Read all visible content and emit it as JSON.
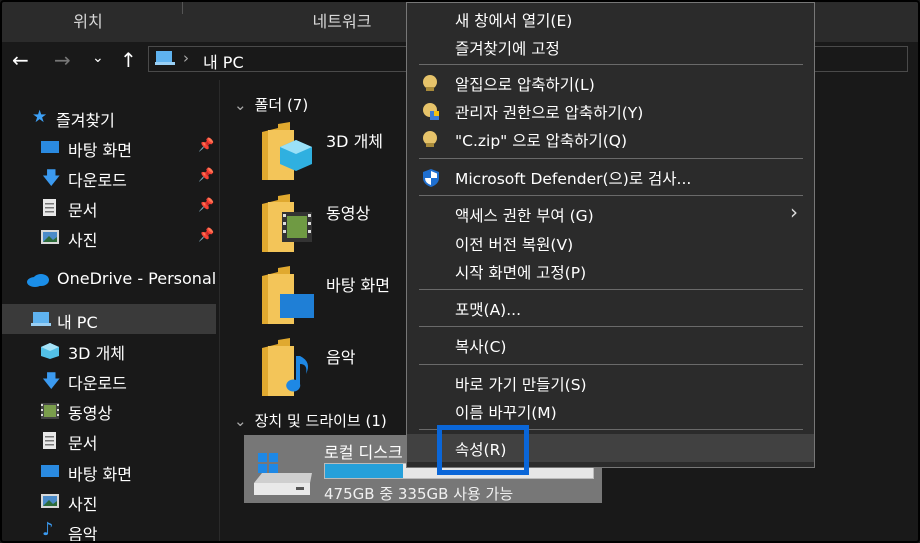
{
  "ribbon": {
    "tabs": [
      "위치",
      "네트워크"
    ]
  },
  "address": {
    "location": "내 PC"
  },
  "sidebar": {
    "quick_access": "즐겨찾기",
    "pinned": [
      {
        "label": "바탕 화면",
        "icon": "desktop-icon"
      },
      {
        "label": "다운로드",
        "icon": "download-icon"
      },
      {
        "label": "문서",
        "icon": "documents-icon"
      },
      {
        "label": "사진",
        "icon": "pictures-icon"
      }
    ],
    "onedrive": "OneDrive - Personal",
    "this_pc": "내 PC",
    "pc_items": [
      {
        "label": "3D 개체",
        "icon": "3d-objects-icon"
      },
      {
        "label": "다운로드",
        "icon": "download-icon"
      },
      {
        "label": "동영상",
        "icon": "videos-icon"
      },
      {
        "label": "문서",
        "icon": "documents-icon"
      },
      {
        "label": "바탕 화면",
        "icon": "desktop-icon"
      },
      {
        "label": "사진",
        "icon": "pictures-icon"
      },
      {
        "label": "음악",
        "icon": "music-icon"
      }
    ]
  },
  "content": {
    "folders_header": "폴더 (7)",
    "folders": [
      "3D 개체",
      "동영상",
      "바탕 화면",
      "음악"
    ],
    "drives_header": "장치 및 드라이브 (1)",
    "drive": {
      "name": "로컬 디스크 (C:)",
      "free": "475GB 중 335GB 사용 가능",
      "used_fraction": 0.29
    }
  },
  "context_menu": {
    "items": [
      "새 창에서 열기(E)",
      "즐겨찾기에 고정",
      "알집으로 압축하기(L)",
      "관리자 권한으로 압축하기(Y)",
      "\"C.zip\" 으로 압축하기(Q)",
      "Microsoft Defender(으)로 검사...",
      "액세스 권한 부여 (G)",
      "이전 버전 복원(V)",
      "시작 화면에 고정(P)",
      "포맷(A)...",
      "복사(C)",
      "바로 가기 만들기(S)",
      "이름 바꾸기(M)",
      "속성(R)"
    ]
  },
  "colors": {
    "accent": "#0a66d8",
    "drive_bar": "#26a0da",
    "folder": "#f3c559"
  }
}
